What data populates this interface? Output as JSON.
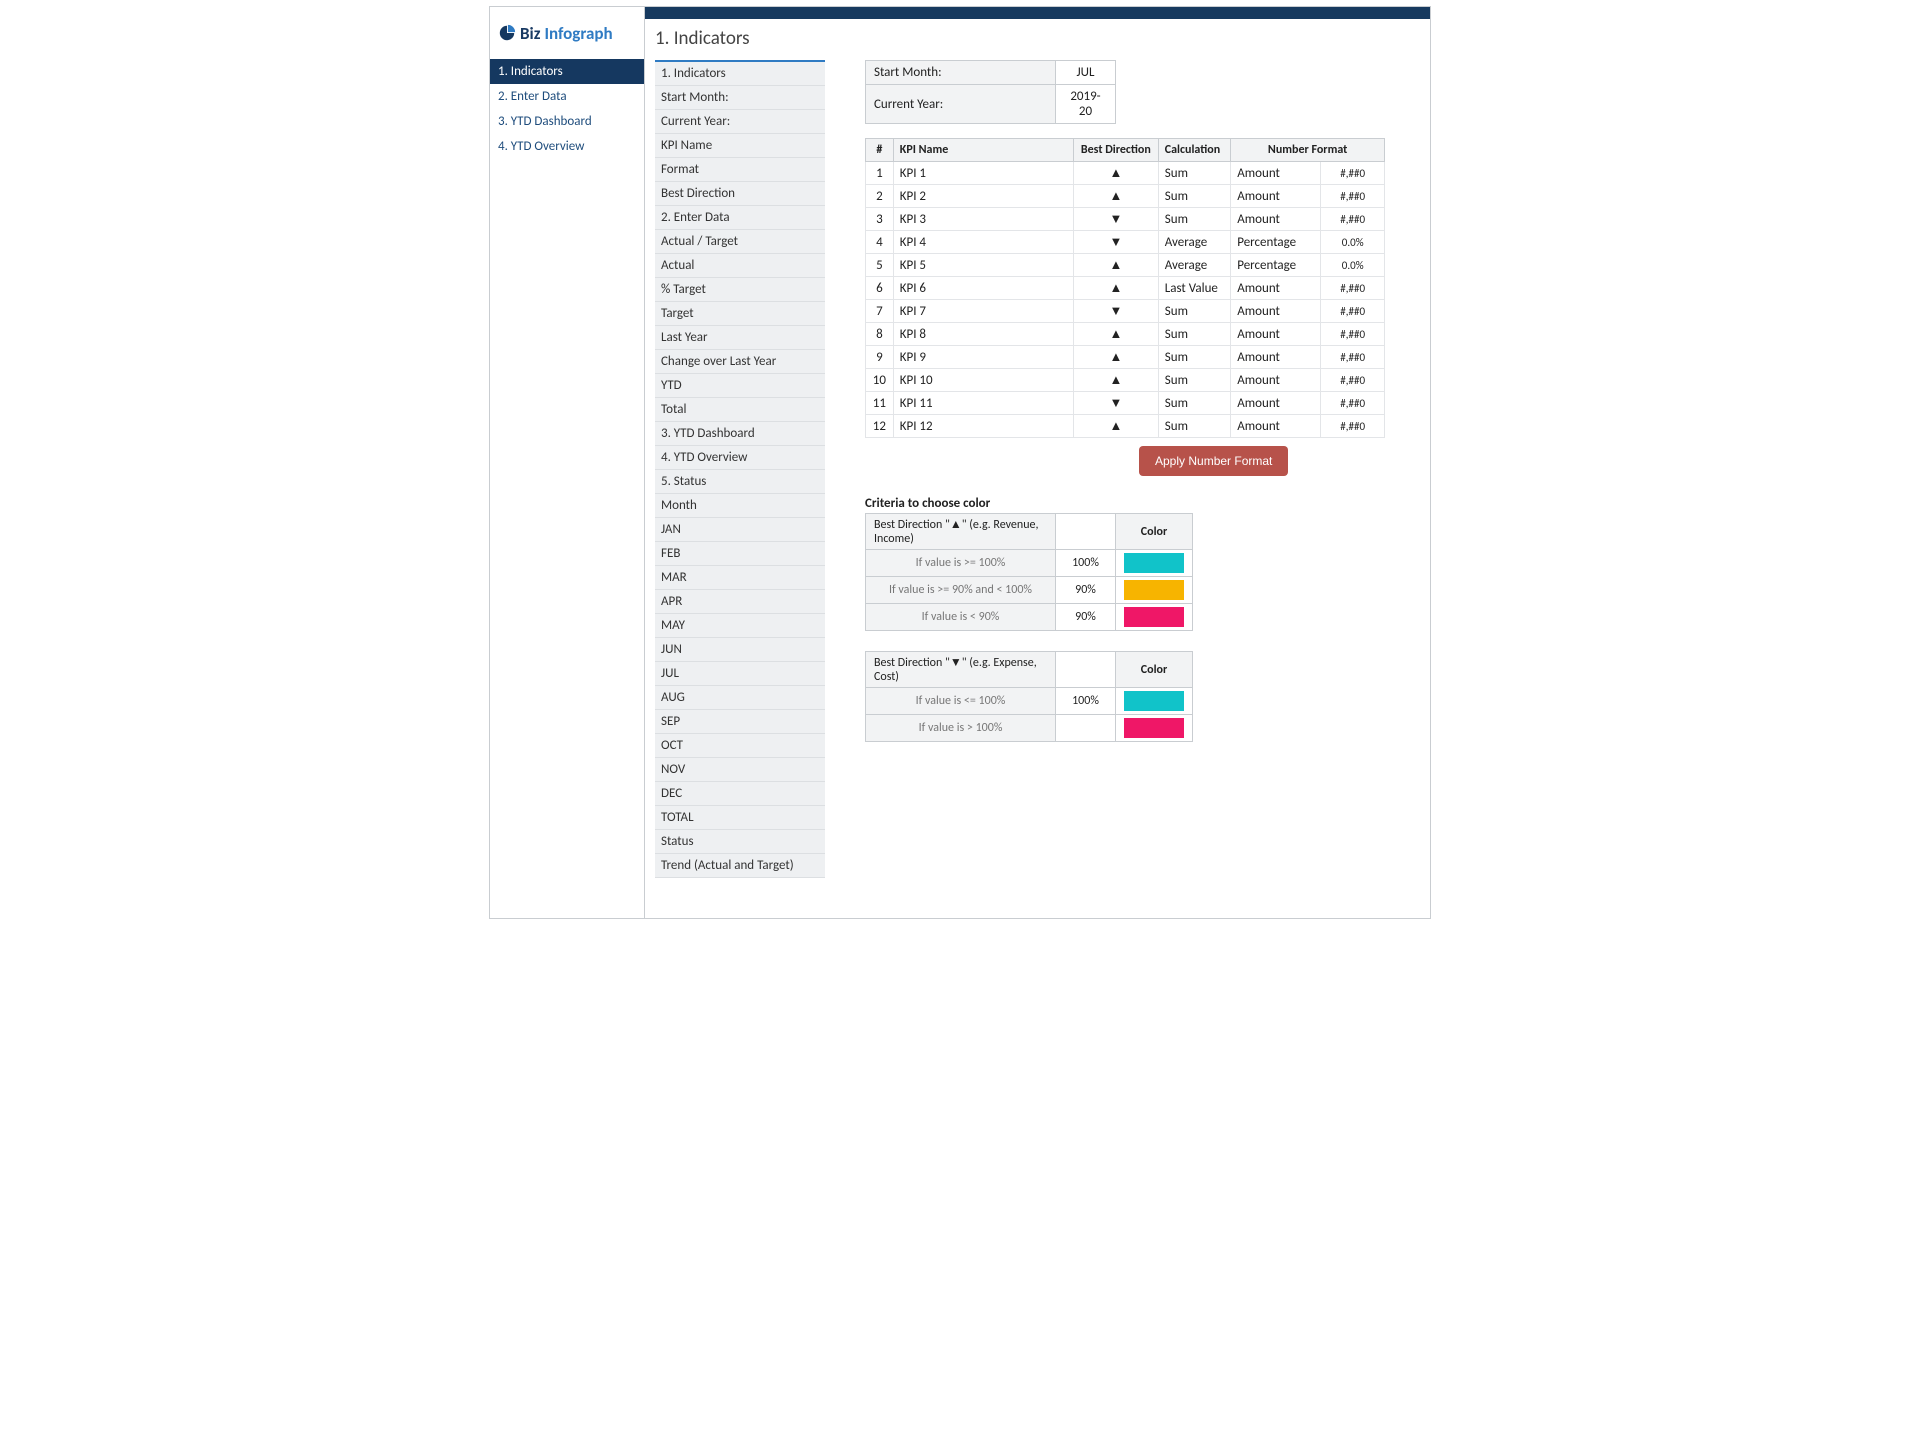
{
  "brand": {
    "biz": "Biz",
    "info": "Infograph"
  },
  "page_title": "1. Indicators",
  "sidebar_items": [
    {
      "label": "1. Indicators",
      "active": true
    },
    {
      "label": "2. Enter Data",
      "active": false
    },
    {
      "label": "3. YTD Dashboard",
      "active": false
    },
    {
      "label": "4. YTD Overview",
      "active": false
    }
  ],
  "subnav_items": [
    "1. Indicators",
    "Start Month:",
    "Current Year:",
    "KPI Name",
    "Format",
    "Best Direction",
    "2. Enter Data",
    "Actual / Target",
    "Actual",
    "% Target",
    "Target",
    "Last Year",
    "Change over Last Year",
    "YTD",
    "Total",
    "3. YTD Dashboard",
    "4. YTD Overview",
    "5. Status",
    "Month",
    "JAN",
    "FEB",
    "MAR",
    "APR",
    "MAY",
    "JUN",
    "JUL",
    "AUG",
    "SEP",
    "OCT",
    "NOV",
    "DEC",
    "TOTAL",
    "Status",
    "Trend (Actual and Target)"
  ],
  "info": {
    "start_month_label": "Start Month:",
    "start_month_value": "JUL",
    "current_year_label": "Current Year:",
    "current_year_value": "2019-20"
  },
  "kpi_headers": {
    "num": "#",
    "name": "KPI Name",
    "dir": "Best Direction",
    "calc": "Calculation",
    "fmt": "Number Format"
  },
  "kpi_rows": [
    {
      "n": "1",
      "name": "KPI 1",
      "dir": "▲",
      "calc": "Sum",
      "fmt_type": "Amount",
      "fmt": "#,##0"
    },
    {
      "n": "2",
      "name": "KPI 2",
      "dir": "▲",
      "calc": "Sum",
      "fmt_type": "Amount",
      "fmt": "#,##0"
    },
    {
      "n": "3",
      "name": "KPI 3",
      "dir": "▼",
      "calc": "Sum",
      "fmt_type": "Amount",
      "fmt": "#,##0"
    },
    {
      "n": "4",
      "name": "KPI 4",
      "dir": "▼",
      "calc": "Average",
      "fmt_type": "Percentage",
      "fmt": "0.0%"
    },
    {
      "n": "5",
      "name": "KPI 5",
      "dir": "▲",
      "calc": "Average",
      "fmt_type": "Percentage",
      "fmt": "0.0%"
    },
    {
      "n": "6",
      "name": "KPI 6",
      "dir": "▲",
      "calc": "Last Value",
      "fmt_type": "Amount",
      "fmt": "#,##0"
    },
    {
      "n": "7",
      "name": "KPI 7",
      "dir": "▼",
      "calc": "Sum",
      "fmt_type": "Amount",
      "fmt": "#,##0"
    },
    {
      "n": "8",
      "name": "KPI 8",
      "dir": "▲",
      "calc": "Sum",
      "fmt_type": "Amount",
      "fmt": "#,##0"
    },
    {
      "n": "9",
      "name": "KPI 9",
      "dir": "▲",
      "calc": "Sum",
      "fmt_type": "Amount",
      "fmt": "#,##0"
    },
    {
      "n": "10",
      "name": "KPI 10",
      "dir": "▲",
      "calc": "Sum",
      "fmt_type": "Amount",
      "fmt": "#,##0"
    },
    {
      "n": "11",
      "name": "KPI 11",
      "dir": "▼",
      "calc": "Sum",
      "fmt_type": "Amount",
      "fmt": "#,##0"
    },
    {
      "n": "12",
      "name": "KPI 12",
      "dir": "▲",
      "calc": "Sum",
      "fmt_type": "Amount",
      "fmt": "#,##0"
    }
  ],
  "apply_btn": "Apply Number Format",
  "criteria": {
    "title": "Criteria to choose color",
    "up": {
      "header": "Best Direction \"▲\" (e.g. Revenue, Income)",
      "color_hdr": "Color",
      "rows": [
        {
          "cond": "If value is >= 100%",
          "val": "100%",
          "color": "teal"
        },
        {
          "cond": "If value is >= 90% and < 100%",
          "val": "90%",
          "color": "amber"
        },
        {
          "cond": "If value is < 90%",
          "val": "90%",
          "color": "pink"
        }
      ]
    },
    "down": {
      "header": "Best Direction \"▼\" (e.g. Expense, Cost)",
      "color_hdr": "Color",
      "rows": [
        {
          "cond": "If value is <= 100%",
          "val": "100%",
          "color": "teal"
        },
        {
          "cond": "If value is > 100%",
          "val": "",
          "color": "pink"
        }
      ]
    }
  }
}
